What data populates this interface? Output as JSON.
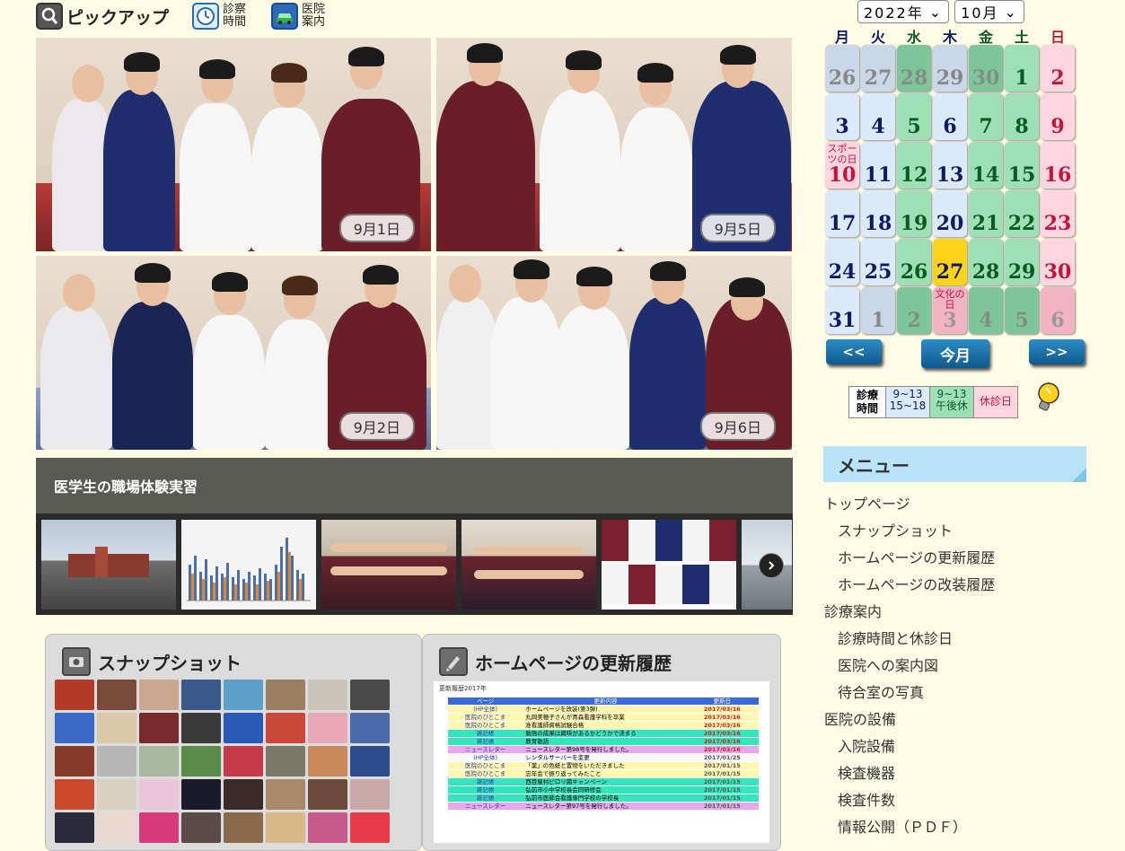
{
  "nav": {
    "pickup": "ピックアップ",
    "hours_line1": "診察",
    "hours_line2": "時間",
    "guide_line1": "医院",
    "guide_line2": "案内"
  },
  "photos": [
    {
      "date": "9月1日"
    },
    {
      "date": "9月5日"
    },
    {
      "date": "9月2日"
    },
    {
      "date": "9月6日"
    }
  ],
  "slider": {
    "title": "医学生の職場体験実習",
    "next_icon": "chevron-right-icon"
  },
  "snapshot": {
    "title": "スナップショット"
  },
  "updates": {
    "title": "ホームページの更新履歴",
    "image_title": "更新履歴2017年",
    "headers": [
      "ページ",
      "更新内容",
      "更新日"
    ],
    "rows": [
      [
        "(HP全体)",
        "ホームページを改装(第3弾)",
        "2017/03/16"
      ],
      [
        "医院のひとこま",
        "丸岡美穂子さんが青森看護学科を卒業",
        "2017/03/16"
      ],
      [
        "医院のひとこま",
        "准看護師資格試験合格",
        "2017/03/16"
      ],
      [
        "雑記帳",
        "勉強の成果は興味があるかどうかで決まる",
        "2017/03/16"
      ],
      [
        "雑記帳",
        "教育勅語",
        "2017/03/16"
      ],
      [
        "ニュースレター",
        "ニュースレター第98号を発行しました。",
        "2017/03/16"
      ],
      [
        "(HP全体)",
        "レンタルサーバーを変更",
        "2017/01/25"
      ],
      [
        "医院のひとこま",
        "「薬」の色紙と置物をいただきました",
        "2017/01/15"
      ],
      [
        "医院のひとこま",
        "忘年会で振り返ってみたこと",
        "2017/01/15"
      ],
      [
        "雑記帳",
        "西目屋村ピロリ菌キャンペーン",
        "2017/01/15"
      ],
      [
        "雑記帳",
        "弘前市小中学校長会同研修会",
        "2017/01/15"
      ],
      [
        "雑記帳",
        "弘前市医師会看護専門学校の学校長",
        "2017/01/15"
      ],
      [
        "ニュースレター",
        "ニュースレター第97号を発行しました。",
        "2017/01/15"
      ]
    ]
  },
  "calendar": {
    "year": "2022年",
    "month": "10月",
    "weekdays": [
      "月",
      "火",
      "水",
      "木",
      "金",
      "土",
      "日"
    ],
    "days": [
      {
        "d": "26",
        "t": "out"
      },
      {
        "d": "27",
        "t": "out"
      },
      {
        "d": "28",
        "t": "out-g"
      },
      {
        "d": "29",
        "t": "out"
      },
      {
        "d": "30",
        "t": "out-g"
      },
      {
        "d": "1",
        "t": "sat"
      },
      {
        "d": "2",
        "t": "sun"
      },
      {
        "d": "3",
        "t": "norm"
      },
      {
        "d": "4",
        "t": "norm"
      },
      {
        "d": "5",
        "t": "wed"
      },
      {
        "d": "6",
        "t": "norm"
      },
      {
        "d": "7",
        "t": "wed"
      },
      {
        "d": "8",
        "t": "sat"
      },
      {
        "d": "9",
        "t": "sun"
      },
      {
        "d": "10",
        "t": "hol",
        "h": "スポーツの日"
      },
      {
        "d": "11",
        "t": "norm"
      },
      {
        "d": "12",
        "t": "wed"
      },
      {
        "d": "13",
        "t": "norm"
      },
      {
        "d": "14",
        "t": "wed"
      },
      {
        "d": "15",
        "t": "sat"
      },
      {
        "d": "16",
        "t": "sun"
      },
      {
        "d": "17",
        "t": "norm"
      },
      {
        "d": "18",
        "t": "norm"
      },
      {
        "d": "19",
        "t": "wed"
      },
      {
        "d": "20",
        "t": "norm"
      },
      {
        "d": "21",
        "t": "wed"
      },
      {
        "d": "22",
        "t": "sat"
      },
      {
        "d": "23",
        "t": "sun"
      },
      {
        "d": "24",
        "t": "norm"
      },
      {
        "d": "25",
        "t": "norm"
      },
      {
        "d": "26",
        "t": "wed"
      },
      {
        "d": "27",
        "t": "today"
      },
      {
        "d": "28",
        "t": "wed"
      },
      {
        "d": "29",
        "t": "sat"
      },
      {
        "d": "30",
        "t": "sun"
      },
      {
        "d": "31",
        "t": "norm"
      },
      {
        "d": "1",
        "t": "out"
      },
      {
        "d": "2",
        "t": "out-g"
      },
      {
        "d": "3",
        "t": "out-s",
        "h": "文化の日"
      },
      {
        "d": "4",
        "t": "out-g"
      },
      {
        "d": "5",
        "t": "out-g"
      },
      {
        "d": "6",
        "t": "out-s"
      }
    ],
    "prev_label": "<<",
    "today_label": "今月",
    "next_label": ">>",
    "legend": {
      "label": "診療時間",
      "normal": "9~13 15~18",
      "half": "9~13 午後休",
      "closed": "休診日"
    }
  },
  "menu": {
    "title": "メニュー",
    "items": [
      {
        "label": "トップページ",
        "sub": false
      },
      {
        "label": "スナップショット",
        "sub": true
      },
      {
        "label": "ホームページの更新履歴",
        "sub": true
      },
      {
        "label": "ホームページの改装履歴",
        "sub": true
      },
      {
        "label": "診療案内",
        "sub": false
      },
      {
        "label": "診療時間と休診日",
        "sub": true
      },
      {
        "label": "医院への案内図",
        "sub": true
      },
      {
        "label": "待合室の写真",
        "sub": true
      },
      {
        "label": "医院の設備",
        "sub": false
      },
      {
        "label": "入院設備",
        "sub": true
      },
      {
        "label": "検査機器",
        "sub": true
      },
      {
        "label": "検査件数",
        "sub": true
      },
      {
        "label": "情報公開（ＰＤＦ）",
        "sub": true
      }
    ]
  },
  "colors": {
    "background": "#fffce6",
    "menu_header": "#b9e4f7",
    "button": "#1a6fa8",
    "today": "#ffd21a"
  }
}
